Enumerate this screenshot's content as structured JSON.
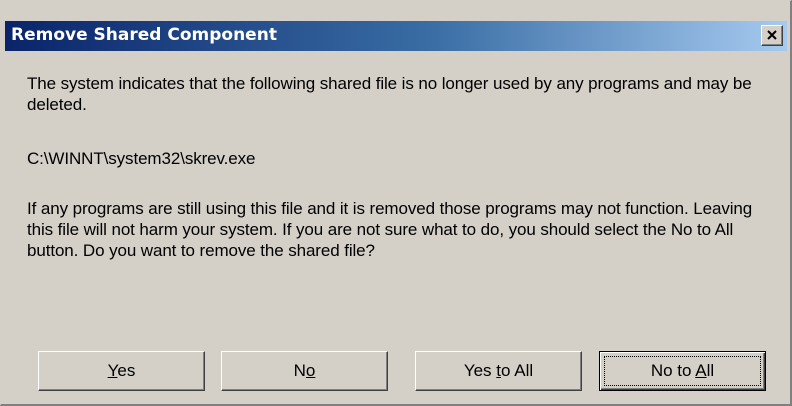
{
  "dialog": {
    "title": "Remove Shared Component",
    "message_line1": "The system indicates that the following shared file is no longer used by any programs and may be deleted.",
    "file_path": "C:\\WINNT\\system32\\skrev.exe",
    "message_line2": "If any programs are still using this file and it is removed those programs may not function. Leaving this file will not harm your system. If you are not sure what to do, you should select the No to All button. Do you want to remove the shared file?"
  },
  "buttons": {
    "yes": {
      "pre": "",
      "accel": "Y",
      "post": "es"
    },
    "no": {
      "pre": "N",
      "accel": "o",
      "post": ""
    },
    "yes_to_all": {
      "pre": "Yes ",
      "accel": "t",
      "post": "o All"
    },
    "no_to_all": {
      "pre": "No to ",
      "accel": "A",
      "post": "ll"
    }
  },
  "colors": {
    "titlebar_start": "#0a246a",
    "titlebar_end": "#a6caf0",
    "face": "#d4d0c8"
  },
  "icons": {
    "close": "close-icon"
  }
}
